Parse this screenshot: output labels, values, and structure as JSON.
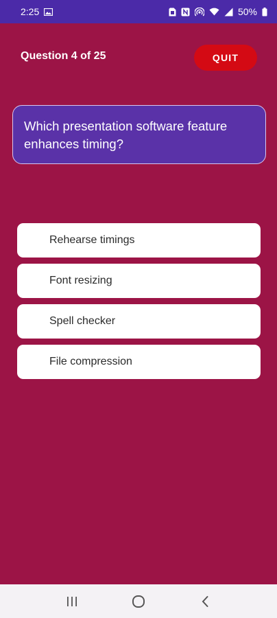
{
  "status_bar": {
    "time": "2:25",
    "battery": "50%",
    "icons": [
      "image-icon",
      "sim-icon",
      "nfc-icon",
      "hotspot-icon",
      "wifi-icon",
      "signal-icon",
      "battery-icon"
    ]
  },
  "header": {
    "question_counter": "Question 4 of 25",
    "quit_label": "QUIT"
  },
  "question": {
    "text": "Which presentation software feature enhances timing?"
  },
  "answers": [
    {
      "label": "Rehearse timings"
    },
    {
      "label": "Font resizing"
    },
    {
      "label": "Spell checker"
    },
    {
      "label": "File compression"
    }
  ],
  "nav_bar": {
    "icons": [
      "recents-icon",
      "home-icon",
      "back-icon"
    ]
  },
  "colors": {
    "background": "#9c1446",
    "status_bar": "#4b2aa8",
    "question_card": "#5a32a8",
    "quit_button": "#d40a14",
    "answer_card": "#ffffff"
  }
}
